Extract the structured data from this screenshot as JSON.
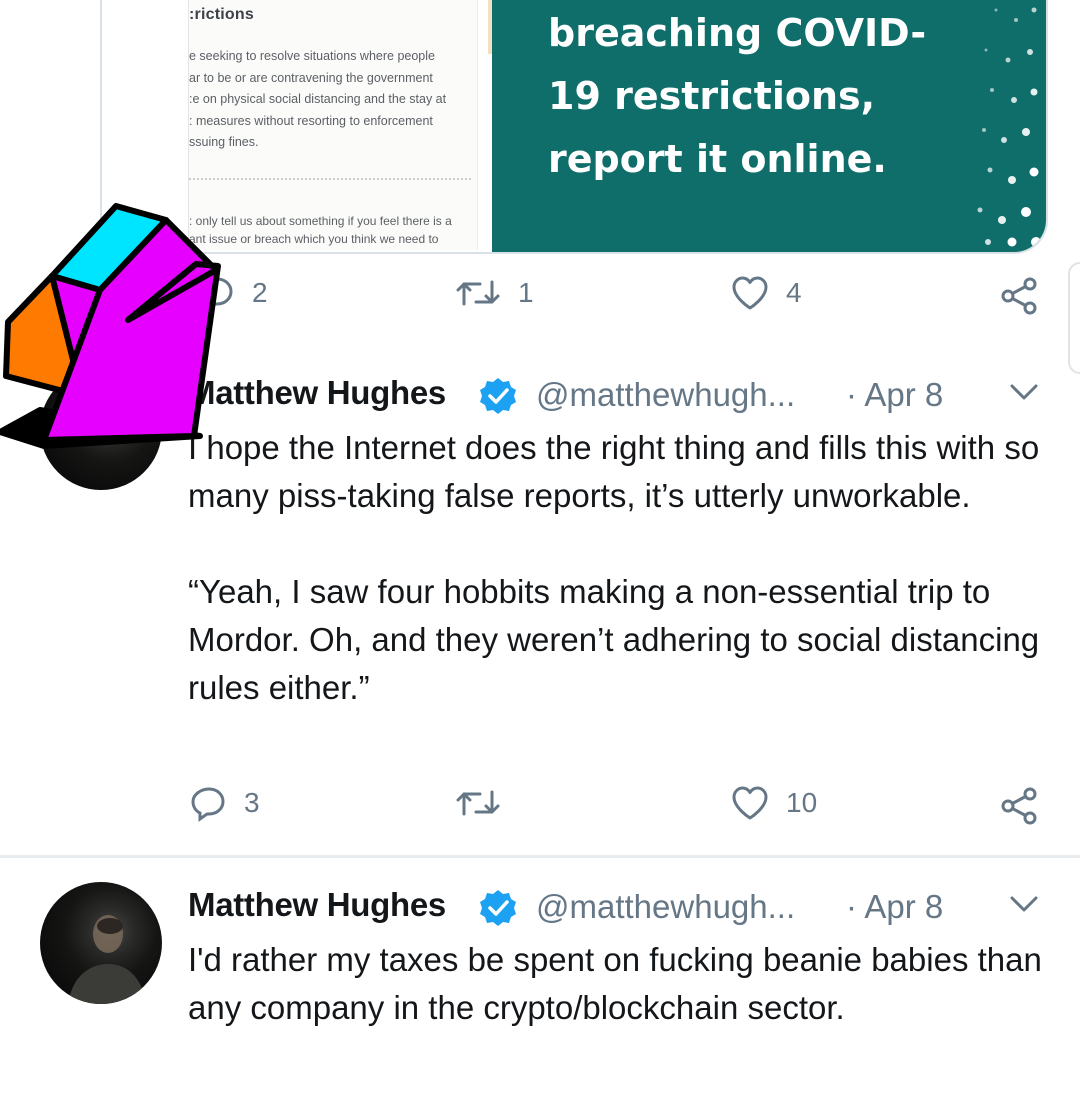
{
  "embed": {
    "doc_heading": ":rictions",
    "doc_paragraph": "e seeking to resolve situations where people\nar to be or are contravening the government\n:e on physical social distancing and the stay at\n: measures without resorting to enforcement\nssuing fines.",
    "doc_paragraph2": ": only tell us about something if you feel there is a\nant issue or breach which you think we need to",
    "promo_text": "breaching COVID-\n19 restrictions,\nreport it online."
  },
  "prev_actions": {
    "reply": "2",
    "retweet": "1",
    "like": "4"
  },
  "tweet1": {
    "name": "Matthew Hughes",
    "handle": "@matthewhugh...",
    "date": "· Apr 8",
    "body": "I hope the Internet does the right thing and fills this with so many piss-taking false reports, it’s utterly unworkable.\n\n“Yeah, I saw four hobbits making a non-essential trip to Mordor. Oh, and they weren’t adhering to social distancing rules either.”",
    "reply_count": "3",
    "retweet_count": "",
    "like_count": "10"
  },
  "tweet2": {
    "name": "Matthew Hughes",
    "handle": "@matthewhugh...",
    "date": "· Apr 8",
    "body": "I'd rather my taxes be spent on fucking beanie babies than any company in the crypto/blockchain sector."
  },
  "colors": {
    "accent_blue": "#1da1f2",
    "promo_teal": "#0f6d6a",
    "arrow_magenta": "#e600ff",
    "arrow_cyan": "#00e5ff",
    "arrow_orange": "#ff7a00",
    "muted_grey": "#657786"
  },
  "icons": [
    "reply-icon",
    "retweet-icon",
    "like-icon",
    "share-icon",
    "verified-icon",
    "chevron-down-icon"
  ]
}
